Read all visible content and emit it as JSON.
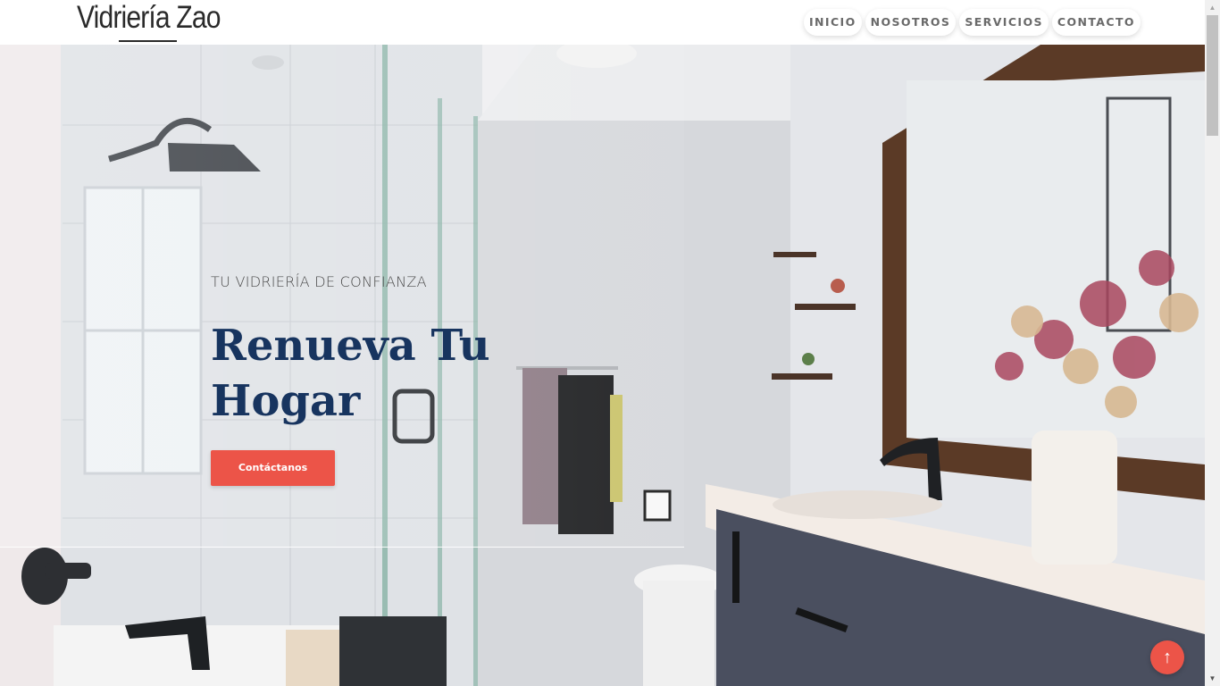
{
  "header": {
    "brand": "Vidriería Zao",
    "nav": [
      "INICIO",
      "NOSOTROS",
      "SERVICIOS",
      "CONTACTO"
    ]
  },
  "hero": {
    "tagline": "TU VIDRIERÍA DE CONFIANZA",
    "title": "Renueva Tu Hogar",
    "cta_label": "Contáctanos"
  },
  "controls": {
    "back_to_top_icon": "arrow-up-icon",
    "back_to_top_glyph": "↑",
    "scroll_up_glyph": "▲",
    "scroll_down_glyph": "▼"
  },
  "colors": {
    "accent": "#ec5448",
    "title": "#17345f",
    "nav_text": "#6a6a6a"
  }
}
